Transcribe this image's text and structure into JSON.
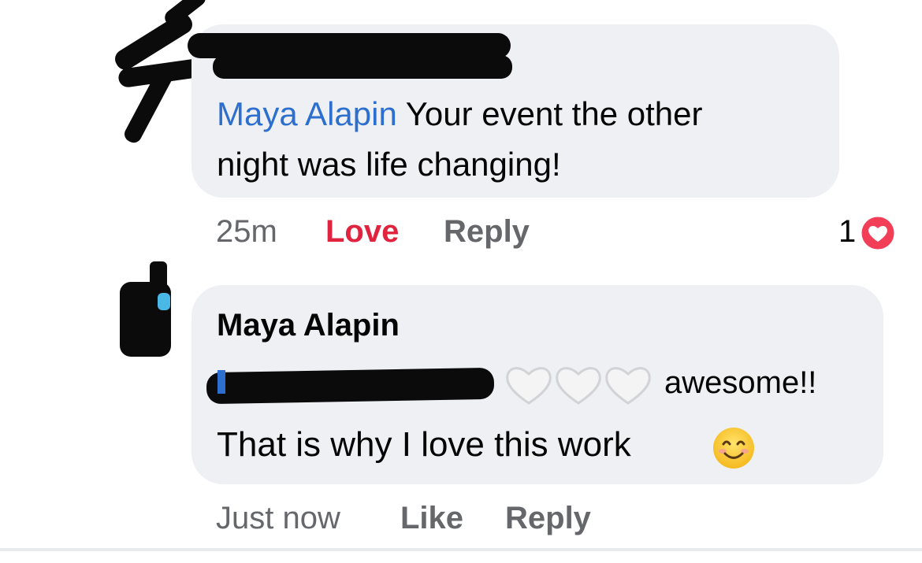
{
  "comment1": {
    "mention": "Maya Alapin",
    "text_line1": "Your event the other",
    "text_line2": "night was life changing!",
    "time": "25m",
    "reaction_label": "Love",
    "reply_label": "Reply",
    "reaction_count": "1",
    "reaction_icon": "heart-reaction-icon",
    "reaction_color": "#f33e58"
  },
  "comment2": {
    "author": "Maya Alapin",
    "hearts_icon": "white-heart-icon",
    "line1_suffix": "awesome!!",
    "line2": "That is why I love this work",
    "emoji_icon": "smiling-face-icon",
    "time": "Just now",
    "like_label": "Like",
    "reply_label": "Reply"
  },
  "colors": {
    "bubble": "#eef0f3",
    "mention_blue": "#2d6fcf",
    "love_red": "#e0243f",
    "meta_gray": "#65676b"
  }
}
